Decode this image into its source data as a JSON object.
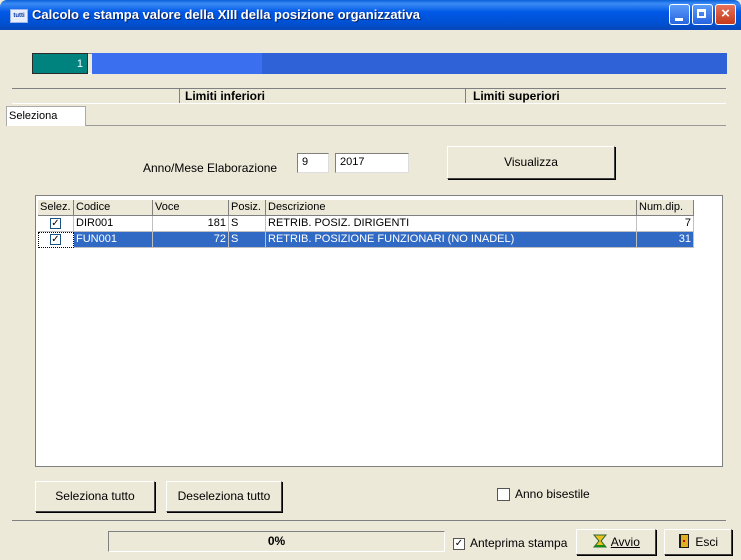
{
  "window": {
    "app_icon_text": "tutti",
    "title": "Calcolo e stampa valore della XIII della posizione organizzativa"
  },
  "progress": {
    "counter": "1",
    "fraction": 0.23
  },
  "limits": {
    "inferiori": "Limiti inferiori",
    "superiori": "Limiti superiori"
  },
  "tabs": [
    {
      "label": "Seleziona"
    }
  ],
  "form": {
    "anno_mese_label": "Anno/Mese Elaborazione",
    "month": "9",
    "year": "2017",
    "visualizza_label": "Visualizza"
  },
  "grid": {
    "columns": [
      "Selez.",
      "Codice",
      "Voce",
      "Posiz.",
      "Descrizione",
      "Num.dip."
    ],
    "rows": [
      {
        "checked": true,
        "codice": "DIR001",
        "voce": "181",
        "posiz": "S",
        "descrizione": "RETRIB. POSIZ. DIRIGENTI",
        "num_dip": "7",
        "selected": false
      },
      {
        "checked": true,
        "codice": "FUN001",
        "voce": "72",
        "posiz": "S",
        "descrizione": "RETRIB. POSIZIONE FUNZIONARI (NO INADEL)",
        "num_dip": "31",
        "selected": true
      }
    ]
  },
  "buttons": {
    "seleziona_tutto": "Seleziona tutto",
    "deseleziona_tutto": "Deseleziona tutto",
    "avvio": "Avvio",
    "esci": "Esci"
  },
  "options": {
    "anno_bisestile": {
      "label": "Anno bisestile",
      "checked": false
    },
    "anteprima_stampa": {
      "label": "Anteprima stampa",
      "checked": true
    }
  },
  "status": {
    "percent": "0%"
  },
  "colors": {
    "selection": "#316ac5",
    "counter_bg": "#00837f",
    "titlebar": "#0058e6"
  }
}
